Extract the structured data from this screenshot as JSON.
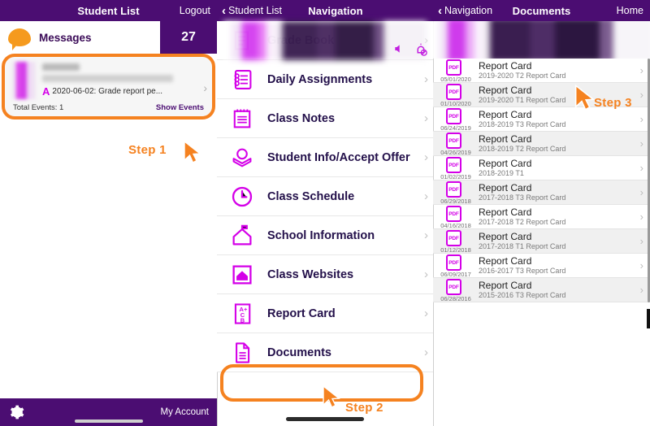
{
  "panel1": {
    "navbar": {
      "title": "Student List",
      "right_action": "Logout"
    },
    "messages": {
      "label": "Messages",
      "count": "27",
      "icon": "speech-bubble-icon"
    },
    "message_card": {
      "grade_badge": "A",
      "grade_text": "2020-06-02: Grade report pe...",
      "total_events": "Total Events: 1",
      "show_events": "Show Events"
    },
    "annotation": {
      "step_label": "Step 1"
    },
    "bottombar": {
      "settings_icon": "gear-icon",
      "account_label": "My Account"
    }
  },
  "panel2": {
    "navbar": {
      "back_label": "Student List",
      "title": "Navigation"
    },
    "header_icons": [
      "speaker-icon",
      "bell-slash-icon"
    ],
    "items": [
      {
        "label": "Grade Book",
        "icon": "grade-book-icon"
      },
      {
        "label": "Daily Assignments",
        "icon": "notebook-icon"
      },
      {
        "label": "Class Notes",
        "icon": "notepad-icon"
      },
      {
        "label": "Student Info/Accept Offer",
        "icon": "student-info-icon"
      },
      {
        "label": "Class Schedule",
        "icon": "clock-icon"
      },
      {
        "label": "School Information",
        "icon": "school-icon"
      },
      {
        "label": "Class Websites",
        "icon": "class-website-icon"
      },
      {
        "label": "Report Card",
        "icon": "report-card-icon"
      },
      {
        "label": "Documents",
        "icon": "document-icon"
      }
    ],
    "annotation": {
      "step_label": "Step 2"
    }
  },
  "panel3": {
    "navbar": {
      "back_label": "Navigation",
      "title": "Documents",
      "right_action": "Home"
    },
    "annotation": {
      "step_label": "Step 3"
    },
    "documents": [
      {
        "date": "05/01/2020",
        "title": "Report Card",
        "subtitle": "2019-2020 T2 Report Card",
        "type": "PDF"
      },
      {
        "date": "01/10/2020",
        "title": "Report Card",
        "subtitle": "2019-2020 T1 Report Card",
        "type": "PDF"
      },
      {
        "date": "06/24/2019",
        "title": "Report Card",
        "subtitle": "2018-2019 T3 Report Card",
        "type": "PDF"
      },
      {
        "date": "04/26/2019",
        "title": "Report Card",
        "subtitle": "2018-2019 T2 Report Card",
        "type": "PDF"
      },
      {
        "date": "01/02/2019",
        "title": "Report Card",
        "subtitle": "2018-2019 T1",
        "type": "PDF"
      },
      {
        "date": "06/29/2018",
        "title": "Report Card",
        "subtitle": "2017-2018 T3 Report Card",
        "type": "PDF"
      },
      {
        "date": "04/16/2018",
        "title": "Report Card",
        "subtitle": "2017-2018 T2 Report Card",
        "type": "PDF"
      },
      {
        "date": "01/12/2018",
        "title": "Report Card",
        "subtitle": "2017-2018 T1 Report Card",
        "type": "PDF"
      },
      {
        "date": "06/09/2017",
        "title": "Report Card",
        "subtitle": "2016-2017 T3 Report Card",
        "type": "PDF"
      },
      {
        "date": "06/28/2016",
        "title": "Report Card",
        "subtitle": "2015-2016 T3 Report Card",
        "type": "PDF"
      }
    ]
  },
  "colors": {
    "header_purple": "#4B0D72",
    "icon_magenta": "#D400E8",
    "accent_orange": "#F58220",
    "bubble_orange": "#F59A1E",
    "row_alt": "#F0F0F0"
  }
}
